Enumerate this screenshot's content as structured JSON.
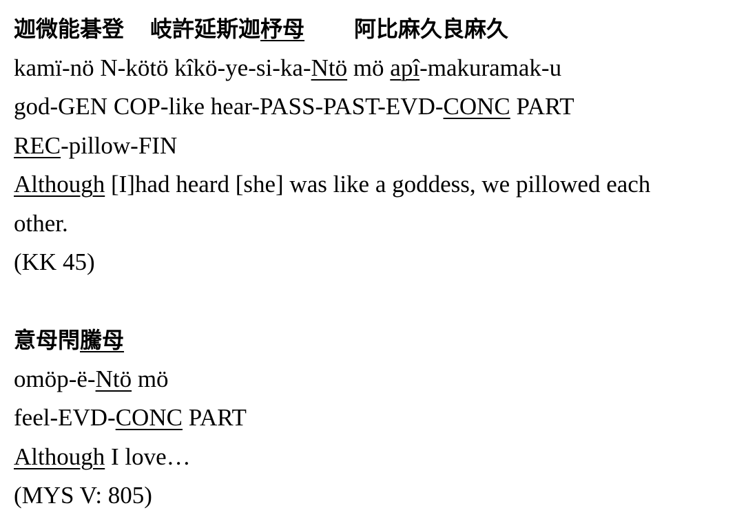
{
  "example1": {
    "japanese": {
      "part1": "迦微能碁登",
      "part2a": "岐許延斯迦",
      "part2b": "杼母",
      "part3": "阿比麻久良麻久"
    },
    "romanization": {
      "a": "kamï-nö N-kötö kîkö-ye-si-ka-",
      "b": "Ntö",
      "c": " mö ",
      "d": "apî",
      "e": "-makuramak-u"
    },
    "gloss": {
      "line1a": "god-GEN COP-like hear-PASS-PAST-EVD-",
      "line1b": "CONC",
      "line1c": " PART",
      "line2a": "REC",
      "line2b": "-pillow-FIN"
    },
    "translation": {
      "a": "Although",
      "b": " [I]had heard [she] was like a goddess, we pillowed each",
      "c": "other."
    },
    "source": "(KK 45)"
  },
  "example2": {
    "japanese": {
      "part1": "意母閇",
      "part2": "騰母"
    },
    "romanization": {
      "a": "omöp-ë-",
      "b": "Ntö",
      "c": " mö"
    },
    "gloss": {
      "a": "feel-EVD-",
      "b": "CONC",
      "c": " PART"
    },
    "translation": {
      "a": "Although",
      "b": " I love…"
    },
    "source": "(MYS V: 805)"
  }
}
